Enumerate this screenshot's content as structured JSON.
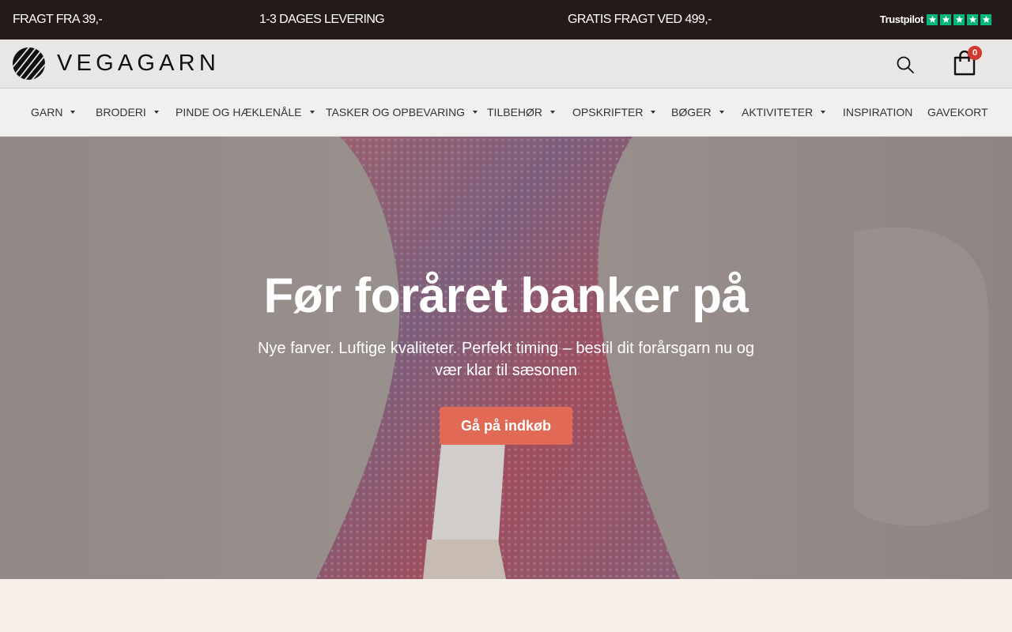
{
  "topbar": {
    "messages": [
      "FRAGT FRA 39,-",
      "1-3 DAGES LEVERING",
      "GRATIS FRAGT VED 499,-"
    ],
    "trustpilot_label": "Trustpilot",
    "trustpilot_stars": 5,
    "trustpilot_color": "#00b67a"
  },
  "header": {
    "logo_text": "VEGAGARN",
    "cart_count": "0"
  },
  "nav": {
    "items": [
      {
        "label": "GARN",
        "dropdown": true
      },
      {
        "label": "BRODERI",
        "dropdown": true
      },
      {
        "label": "PINDE OG HÆKLENÅLE",
        "dropdown": true
      },
      {
        "label": "TASKER OG OPBEVARING",
        "dropdown": true
      },
      {
        "label": "TILBEHØR",
        "dropdown": true
      },
      {
        "label": "OPSKRIFTER",
        "dropdown": true
      },
      {
        "label": "BØGER",
        "dropdown": true
      },
      {
        "label": "AKTIVITETER",
        "dropdown": true
      },
      {
        "label": "INSPIRATION",
        "dropdown": false
      },
      {
        "label": "GAVEKORT",
        "dropdown": false
      }
    ]
  },
  "hero": {
    "title": "Før foråret banker på",
    "subtitle": "Nye farver. Luftige kvaliteter. Perfekt timing – bestil dit forårsgarn nu og vær klar til sæsonen",
    "cta_label": "Gå på indkøb",
    "cta_color": "#e06a55"
  },
  "colors": {
    "topbar_bg": "#231a19",
    "header_bg": "#e8e7e5",
    "nav_bg": "#f0f0ee",
    "badge": "#d3392f",
    "page_bg": "#f7efea"
  }
}
